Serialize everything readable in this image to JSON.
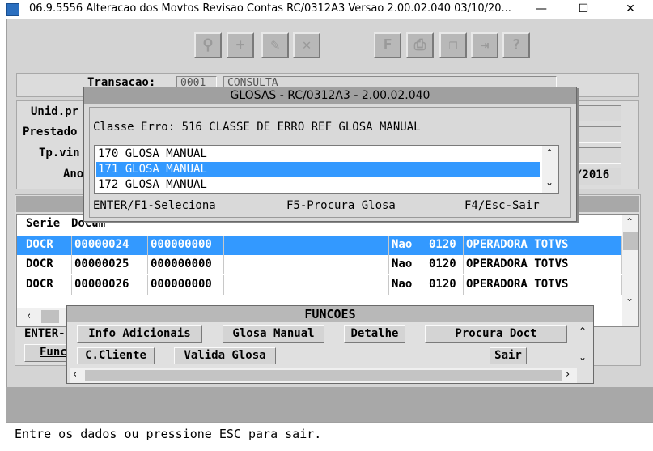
{
  "window": {
    "title": "06.9.5556  Alteracao  dos Movtos Revisao Contas RC/0312A3 Versao 2.00.02.040 03/10/20...",
    "minimize": "—",
    "maximize": "☐",
    "close": "✕"
  },
  "header": {
    "transacao_label": "Transacao:",
    "transacao_code": "0001",
    "transacao_desc": "CONSULTA",
    "unid_label": "Unid.pr",
    "prestador_label": "Prestado",
    "tpvin_label": "Tp.vin",
    "ano_label": "Ano",
    "date_value": "/2016"
  },
  "table": {
    "header_serie": "Serie",
    "header_documento": "Docum",
    "rows": [
      {
        "serie": "DOCR",
        "documento": "00000024",
        "seq": "000000000",
        "col4": "",
        "status": "Nao",
        "code": "0120",
        "operadora": "OPERADORA TOTVS"
      },
      {
        "serie": "DOCR",
        "documento": "00000025",
        "seq": "000000000",
        "col4": "",
        "status": "Nao",
        "code": "0120",
        "operadora": "OPERADORA TOTVS"
      },
      {
        "serie": "DOCR",
        "documento": "00000026",
        "seq": "000000000",
        "col4": "",
        "status": "Nao",
        "code": "0120",
        "operadora": "OPERADORA TOTVS"
      }
    ]
  },
  "behind": {
    "enter_label": "ENTER-",
    "funcoes_btn": "Func"
  },
  "glosas": {
    "title": "GLOSAS - RC/0312A3 - 2.00.02.040",
    "classe_erro": "Classe Erro: 516 CLASSE DE ERRO REF GLOSA MANUAL",
    "items": [
      {
        "label": "170 GLOSA MANUAL"
      },
      {
        "label": "171 GLOSA MANUAL"
      },
      {
        "label": "172 GLOSA MANUAL"
      }
    ],
    "selected_index": 1,
    "hint_select": "ENTER/F1-Seleciona",
    "hint_search": "F5-Procura Glosa",
    "hint_exit": "F4/Esc-Sair"
  },
  "funcoes": {
    "title": "FUNCOES",
    "buttons": {
      "info": "Info Adicionais",
      "glosa": "Glosa Manual",
      "detalhe": "Detalhe",
      "procura": "Procura Doct",
      "cliente": "C.Cliente",
      "valida": "Valida Glosa",
      "sair": "Sair"
    }
  },
  "status": {
    "message": "Entre os dados ou pressione ESC para sair."
  },
  "colors": {
    "selection": "#3399ff",
    "frame": "#d4d4d4"
  }
}
